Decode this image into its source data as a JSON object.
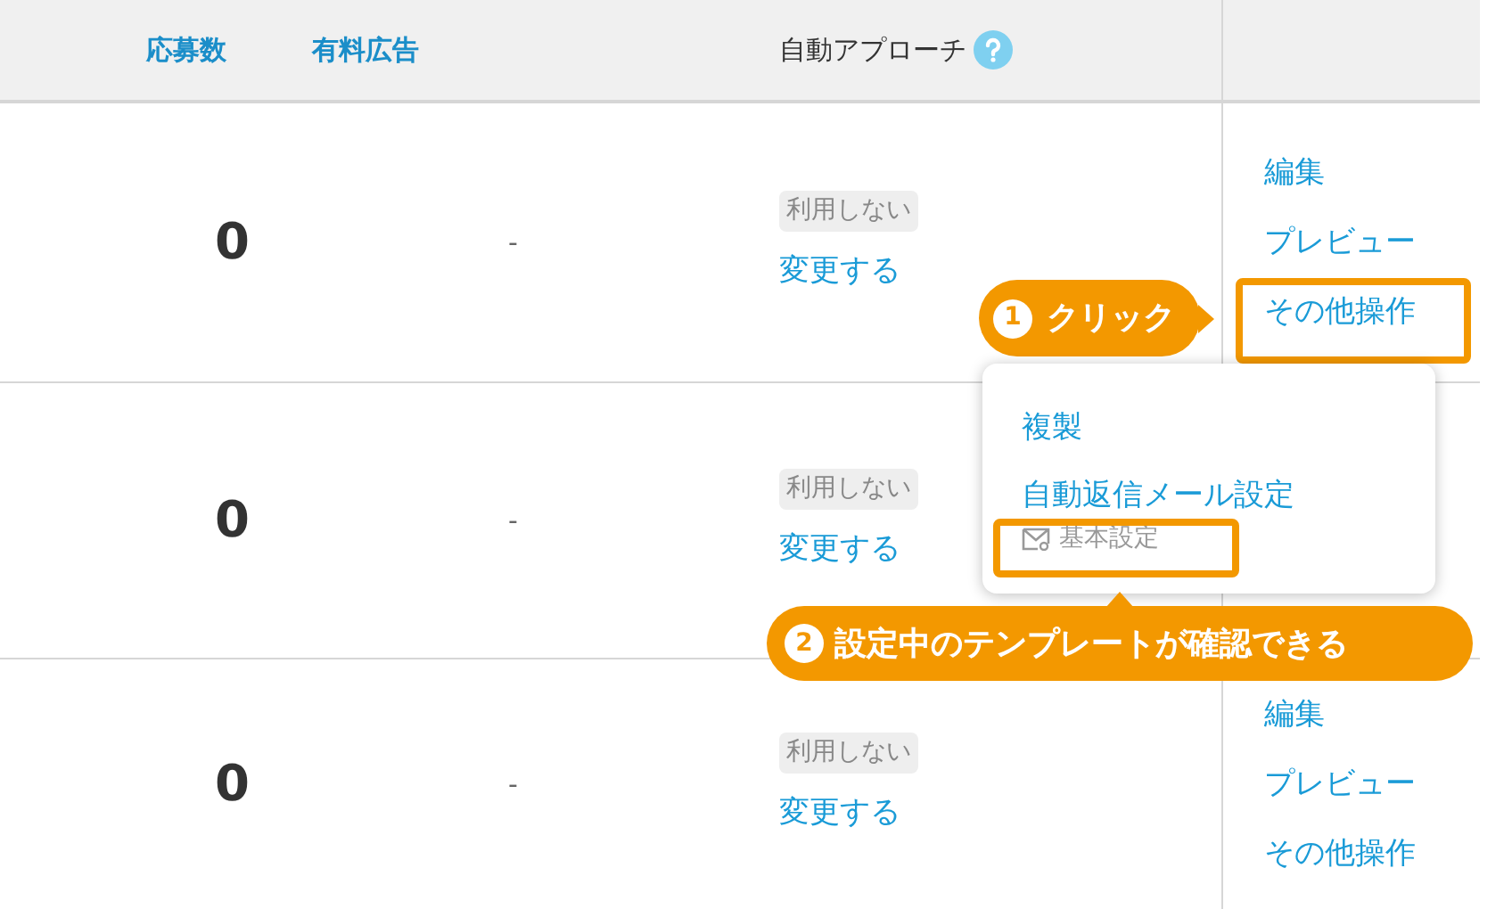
{
  "header": {
    "columns": [
      {
        "label": "応募数",
        "kind": "link"
      },
      {
        "label": "有料広告",
        "kind": "link"
      },
      {
        "label": "自動アプローチ",
        "kind": "help"
      }
    ]
  },
  "rows": [
    {
      "applications": "0",
      "paid_ad": "-",
      "auto_approach": {
        "status": "利用しない",
        "change_link": "変更する"
      },
      "actions": [
        "編集",
        "プレビュー",
        "その他操作"
      ]
    },
    {
      "applications": "0",
      "paid_ad": "-",
      "auto_approach": {
        "status": "利用しない",
        "change_link": "変更する"
      }
    },
    {
      "applications": "0",
      "paid_ad": "-",
      "auto_approach": {
        "status": "利用しない",
        "change_link": "変更する"
      },
      "actions": [
        "編集",
        "プレビュー",
        "その他操作"
      ]
    }
  ],
  "menu": {
    "items": [
      {
        "label": "複製"
      },
      {
        "label": "自動返信メール設定",
        "sub_label": "基本設定"
      }
    ]
  },
  "callouts": [
    {
      "number": "1",
      "text": "クリック"
    },
    {
      "number": "2",
      "text": "設定中のテンプレートが確認できる"
    }
  ]
}
